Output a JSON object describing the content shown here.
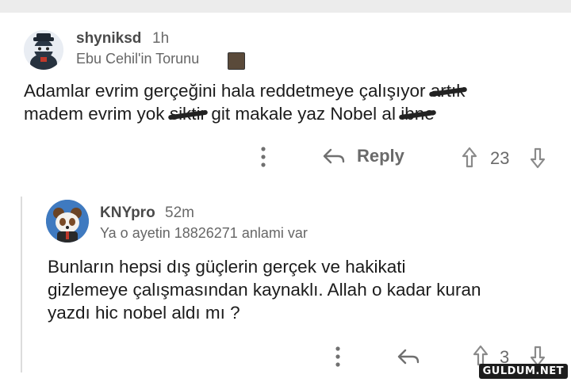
{
  "comments": [
    {
      "username": "shyniksd",
      "time": "1h",
      "flair": "Ebu Cehil'in Torunu",
      "body_line1": "Adamlar evrim gerçeğini hala reddetmeye çalışıyor",
      "body_line1_censored": "artık",
      "body_line2_a": "madem evrim yok",
      "body_line2_censored": "siktir",
      "body_line2_b": "git makale yaz Nobel al",
      "body_line2_censored2": "ibne",
      "reply_label": "Reply",
      "vote_count": "23"
    },
    {
      "username": "KNYpro",
      "time": "52m",
      "flair": "Ya o ayetin 18826271 anlami  var",
      "body_line1": "Bunların hepsi dış güçlerin gerçek ve hakikati",
      "body_line2": "gizlemeye çalışmasından kaynaklı. Allah o kadar kuran",
      "body_line3": "yazdı hic nobel aldı mı ?",
      "vote_count": "3"
    }
  ],
  "watermark": "GULDUM.NET",
  "icons": [
    "more-options-icon",
    "reply-arrow-icon",
    "upvote-icon",
    "downvote-icon"
  ]
}
